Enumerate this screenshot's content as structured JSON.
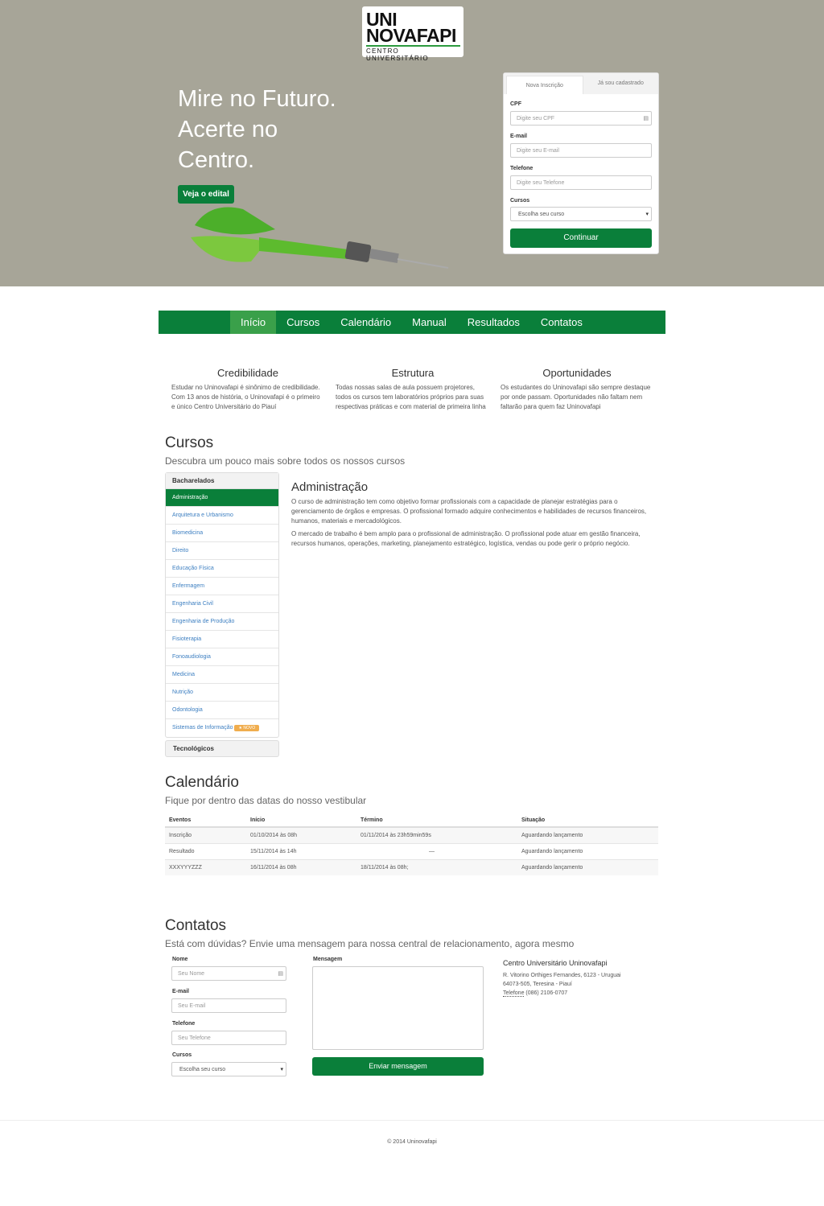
{
  "brand": {
    "logo_line1": "UNI",
    "logo_line2": "NOVAFAPI",
    "logo_line3": "CENTRO UNIVERSITÁRIO",
    "accent": "#0a7f3a"
  },
  "hero": {
    "headline": [
      "Mire no Futuro.",
      "Acerte no",
      "Centro."
    ],
    "cta": "Veja o edital"
  },
  "signup": {
    "tabs": [
      "Nova Inscrição",
      "Já sou cadastrado"
    ],
    "fields": [
      {
        "label": "CPF",
        "placeholder": "Digite seu CPF"
      },
      {
        "label": "E-mail",
        "placeholder": "Digite seu E-mail"
      },
      {
        "label": "Telefone",
        "placeholder": "Digite seu Telefone"
      }
    ],
    "course_label": "Cursos",
    "course_value": "Escolha seu curso",
    "submit": "Continuar"
  },
  "nav": [
    "Início",
    "Cursos",
    "Calendário",
    "Manual",
    "Resultados",
    "Contatos"
  ],
  "features": [
    {
      "title": "Credibilidade",
      "text": "Estudar no Uninovafapi é sinônimo de credibilidade. Com 13 anos de história, o Uninovafapi é o primeiro e único Centro Universitário do Piauí"
    },
    {
      "title": "Estrutura",
      "text": "Todas nossas salas de aula possuem projetores, todos os cursos tem laboratórios próprios para suas respectivas práticas e com material de primeira linha"
    },
    {
      "title": "Oportunidades",
      "text": "Os estudantes do Uninovafapi são sempre destaque por onde passam. Oportunidades não faltam nem faltarão para quem faz Uninovafapi"
    }
  ],
  "cursos": {
    "title": "Cursos",
    "subtitle": "Descubra um pouco mais sobre todos os nossos cursos",
    "group1": "Bacharelados",
    "items": [
      "Administração",
      "Arquitetura e Urbanismo",
      "Biomedicina",
      "Direito",
      "Educação Física",
      "Enfermagem",
      "Engenharia Civil",
      "Engenharia de Produção",
      "Fisioterapia",
      "Fonoaudiologia",
      "Medicina",
      "Nutrição",
      "Odontologia",
      "Sistemas de Informação"
    ],
    "new_badge": "★  NOVO",
    "group2": "Tecnológicos",
    "detail": {
      "title": "Administração",
      "p1": "O curso de administração tem como objetivo formar profissionais com a capacidade de planejar estratégias para o gerenciamento de órgãos e empresas. O profissional formado adquire conhecimentos e habilidades de recursos financeiros, humanos, materiais e mercadológicos.",
      "p2": "O mercado de trabalho é bem amplo para o profissional de administração. O profissional pode atuar em gestão financeira, recursos humanos, operações, marketing, planejamento estratégico, logística, vendas ou pode gerir o próprio negócio."
    }
  },
  "calendario": {
    "title": "Calendário",
    "subtitle": "Fique por dentro das datas do nosso vestibular",
    "columns": [
      "Eventos",
      "Início",
      "Término",
      "Situação"
    ],
    "rows": [
      [
        "Inscrição",
        "01/10/2014 às 08h",
        "01/11/2014 às 23h59min59s",
        "Aguardando lançamento"
      ],
      [
        "Resultado",
        "15/11/2014 às 14h",
        "—",
        "Aguardando lançamento"
      ],
      [
        "XXXYYYZZZ",
        "16/11/2014 às 08h",
        "18/11/2014 às 08h;",
        "Aguardando lançamento"
      ]
    ]
  },
  "contatos": {
    "title": "Contatos",
    "subtitle": "Está com dúvidas? Envie uma mensagem para nossa central de relacionamento, agora mesmo",
    "fields": [
      {
        "label": "Nome",
        "placeholder": "Seu Nome"
      },
      {
        "label": "E-mail",
        "placeholder": "Seu E-mail"
      },
      {
        "label": "Telefone",
        "placeholder": "Seu Telefone"
      }
    ],
    "course_label": "Cursos",
    "course_value": "Escolha seu curso",
    "message_label": "Mensagem",
    "submit": "Enviar mensagem",
    "address": {
      "name": "Centro Universitário Uninovafapi",
      "line1": "R. Vitorino Orthiges Fernandes, 6123 - Uruguai",
      "line2": "64073-505, Teresina - Piauí",
      "phone_label": "Telefone",
      "phone": " (086) 2106-0707"
    }
  },
  "footer": "© 2014 Uninovafapi"
}
